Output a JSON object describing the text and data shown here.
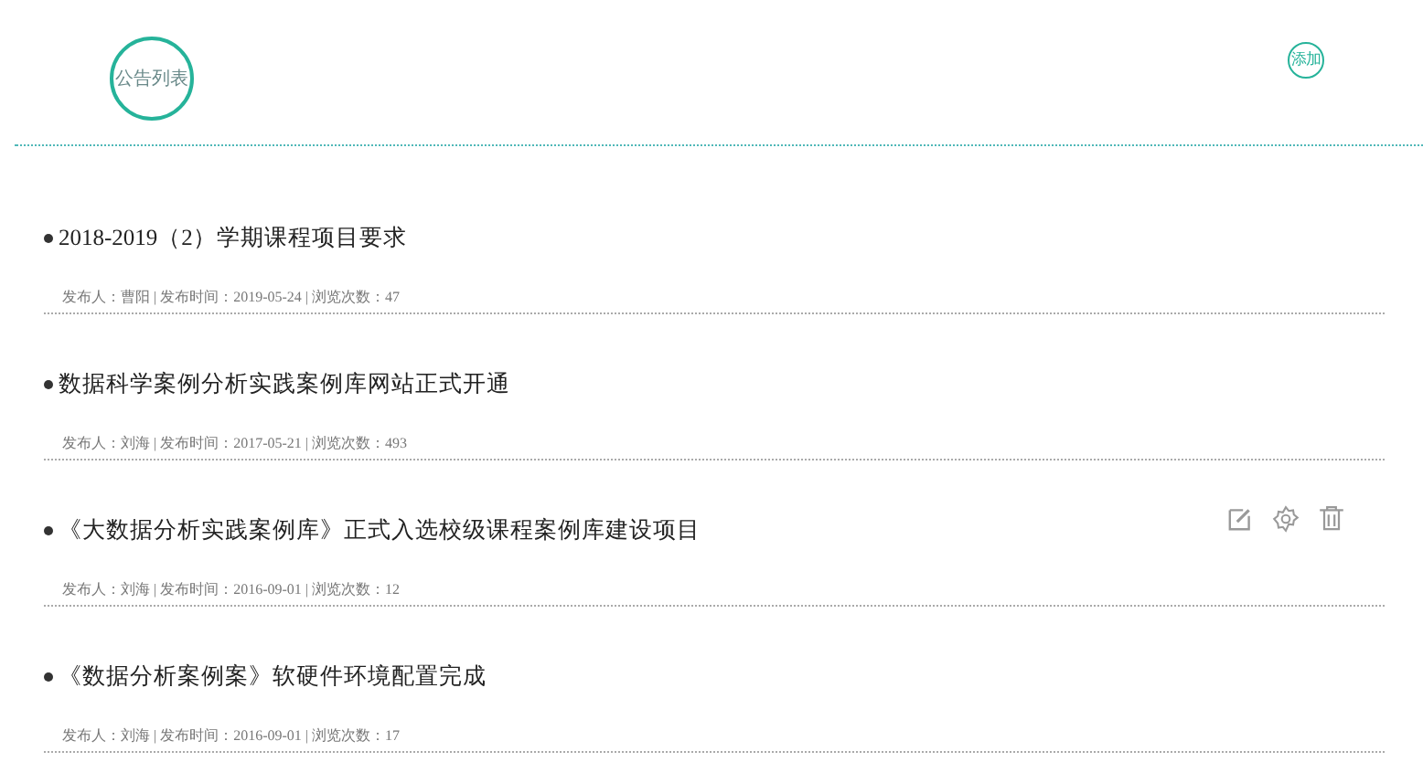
{
  "header": {
    "title": "公告列表",
    "add_button": "添加"
  },
  "announcements": [
    {
      "title": "2018-2019（2）学期课程项目要求",
      "meta": "发布人：曹阳 | 发布时间：2019-05-24 | 浏览次数：47",
      "show_actions": false
    },
    {
      "title": "数据科学案例分析实践案例库网站正式开通",
      "meta": "发布人：刘海 | 发布时间：2017-05-21 | 浏览次数：493",
      "show_actions": false
    },
    {
      "title": "《大数据分析实践案例库》正式入选校级课程案例库建设项目",
      "meta": "发布人：刘海 | 发布时间：2016-09-01 | 浏览次数：12",
      "show_actions": true
    },
    {
      "title": "《数据分析案例案》软硬件环境配置完成",
      "meta": "发布人：刘海 | 发布时间：2016-09-01 | 浏览次数：17",
      "show_actions": false
    }
  ]
}
